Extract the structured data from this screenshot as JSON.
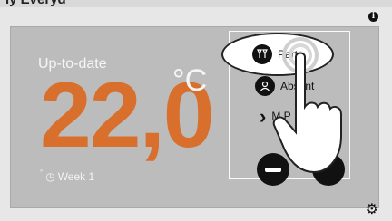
{
  "header": {
    "title": "ly Everyd",
    "info_glyph": "i"
  },
  "status": {
    "label": "Up-to-date"
  },
  "temperature": {
    "value": "22,0",
    "unit": "°C"
  },
  "schedule": {
    "glyph": "°",
    "clock_glyph": "◷",
    "label": "Week 1"
  },
  "menu": {
    "items": [
      {
        "label": "Party",
        "icon": "party-glasses-icon",
        "glyph": "🍸"
      },
      {
        "label": "Absent",
        "icon": "person-icon",
        "glyph": "👤"
      },
      {
        "label": "M P",
        "icon": "chevron-right-icon",
        "glyph": "›"
      }
    ]
  },
  "controls": {
    "minus_label": "−",
    "plus_label": "+"
  },
  "footer": {
    "gear_glyph": "⚙"
  },
  "colors": {
    "accent": "#d86f2c",
    "panel": "#bcbcbc",
    "dark": "#111111"
  }
}
